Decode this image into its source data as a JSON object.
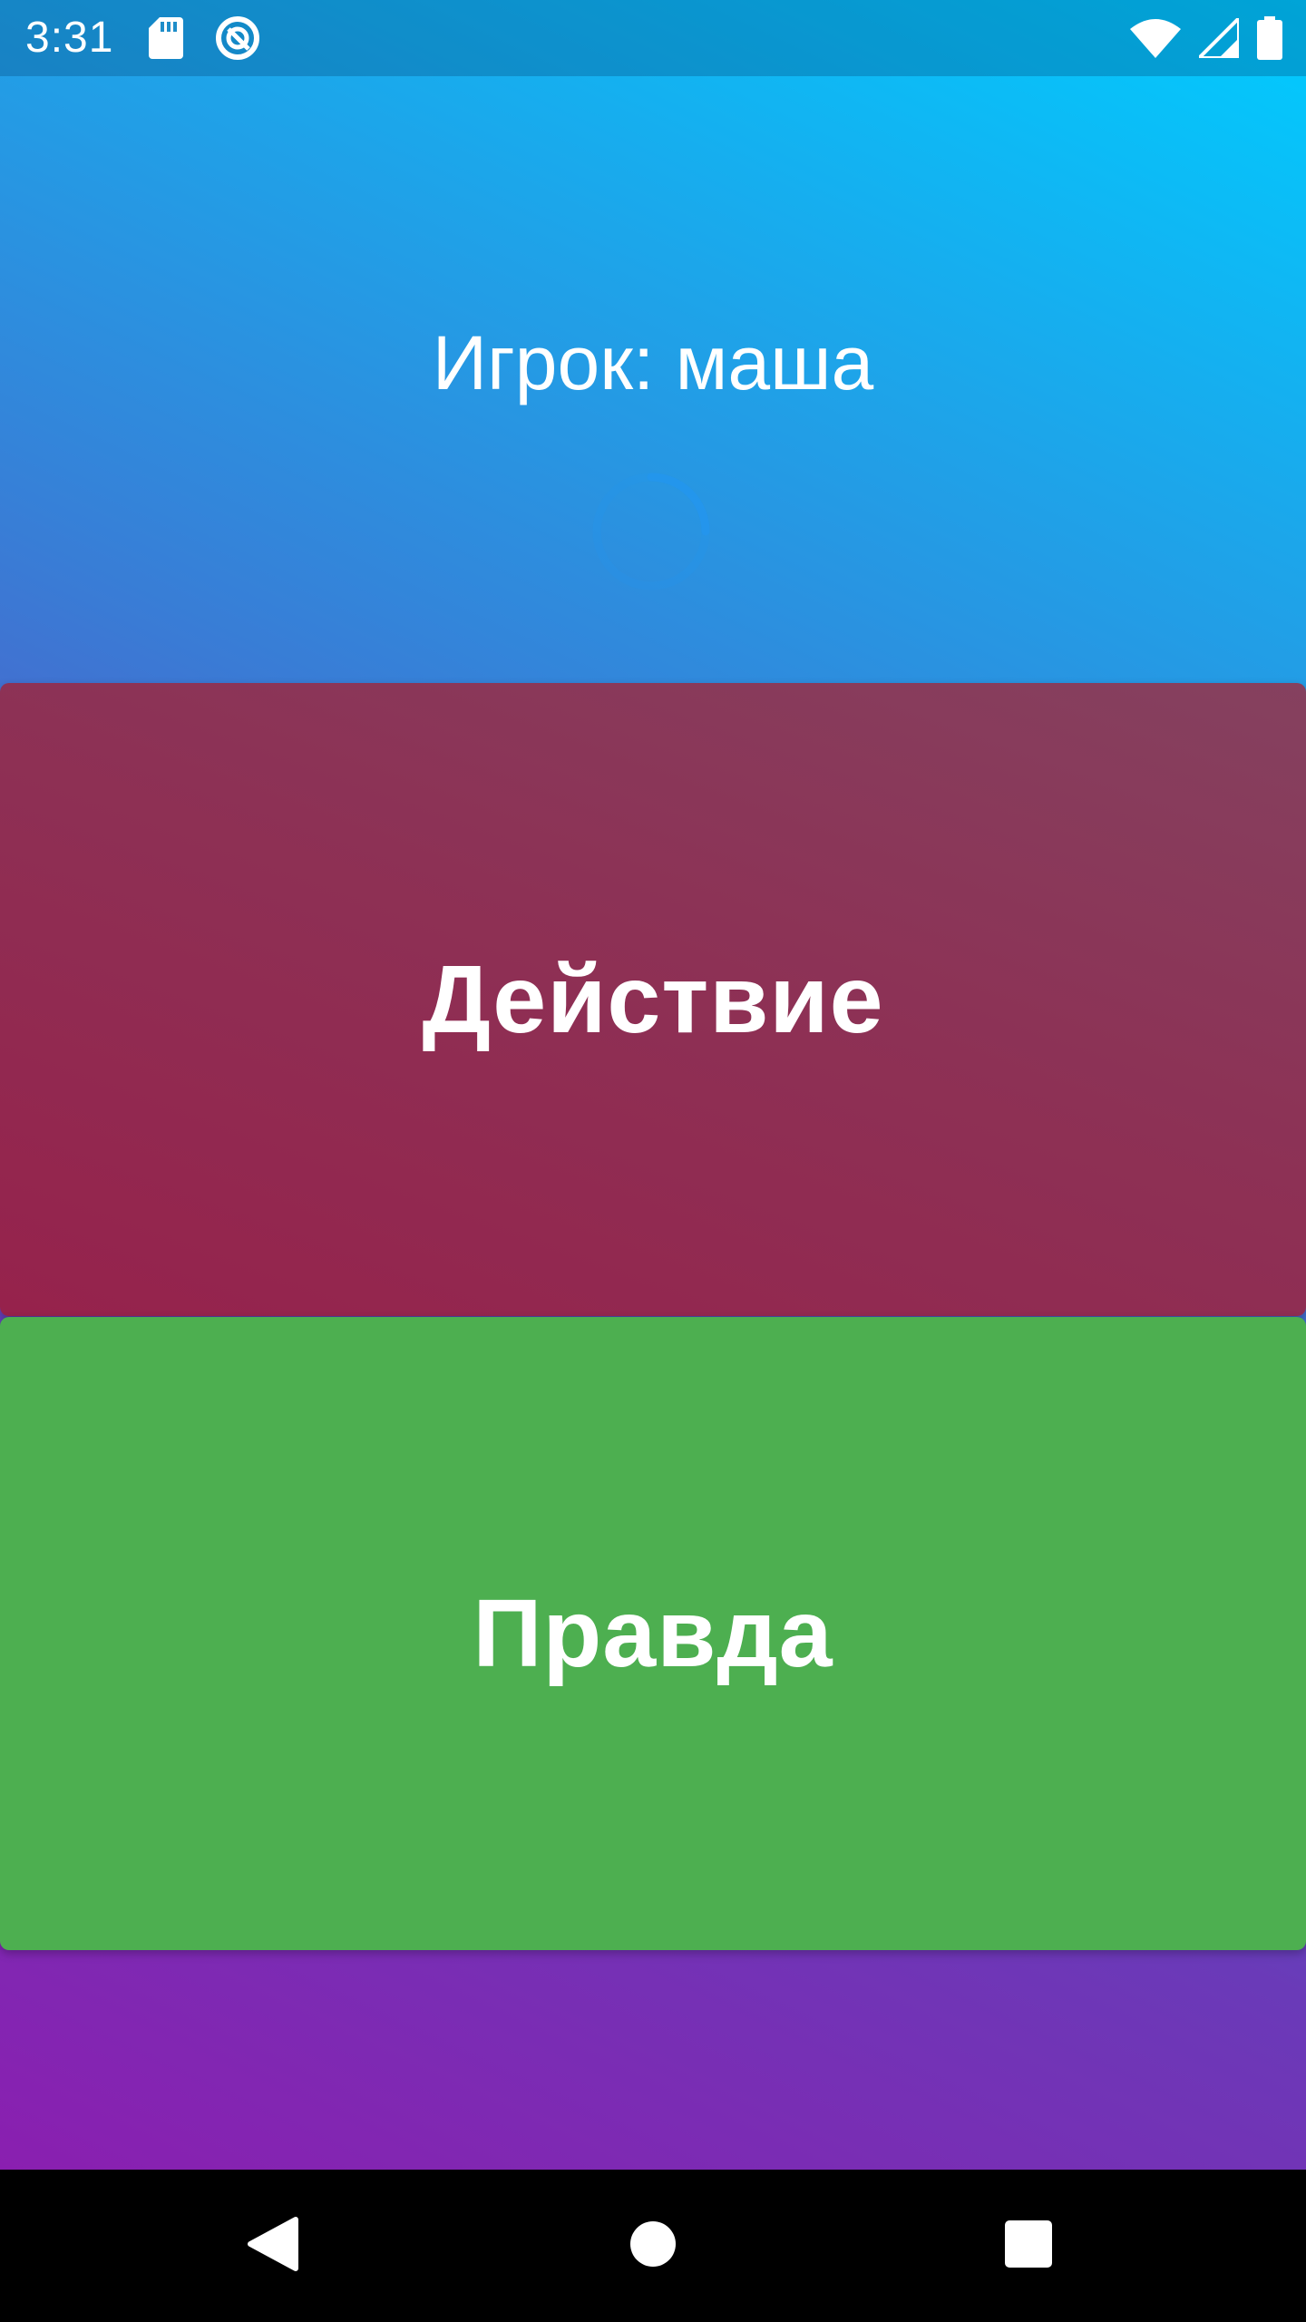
{
  "status_bar": {
    "time": "3:31",
    "icons": [
      "sd-card-icon",
      "sync-icon",
      "wifi-icon",
      "signal-icon",
      "battery-icon"
    ]
  },
  "game": {
    "player_label": "Игрок: маша",
    "loading": true
  },
  "cards": {
    "dare_label": "Действие",
    "truth_label": "Правда"
  },
  "nav_bar": {
    "buttons": [
      "back-icon",
      "home-icon",
      "recents-icon"
    ]
  },
  "colors": {
    "gradient_top": "#00CCFF",
    "gradient_bottom": "#8A1FB0",
    "dare_card": "#8D3155",
    "truth_card": "#4DAF50",
    "spinner": "#2196F3"
  }
}
